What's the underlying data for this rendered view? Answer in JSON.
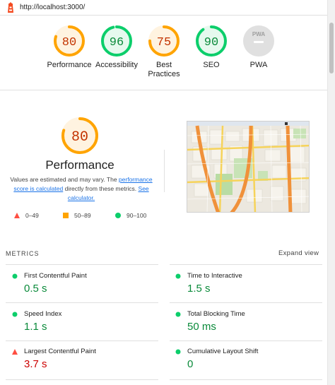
{
  "url": "http://localhost:3000/",
  "colors": {
    "pass": "#0cce6b",
    "average": "#ffa400",
    "fail": "#ff4e42",
    "pass_text": "#0a8a3a",
    "average_text": "#c33300",
    "fail_text": "#cc0000"
  },
  "gauges": [
    {
      "score": "80",
      "label": "Performance",
      "rating": "average",
      "value": 80
    },
    {
      "score": "96",
      "label": "Accessibility",
      "rating": "pass",
      "value": 96
    },
    {
      "score": "75",
      "label_line1": "Best",
      "label_line2": "Practices",
      "rating": "average",
      "value": 75
    },
    {
      "score": "90",
      "label": "SEO",
      "rating": "pass",
      "value": 90
    },
    {
      "score": "PWA",
      "label": "PWA",
      "rating": "na"
    }
  ],
  "performance": {
    "score": "80",
    "value": 80,
    "title": "Performance",
    "desc_1": "Values are estimated and may vary. The ",
    "link_1": "performance score is calculated",
    "desc_2": " directly from these metrics. ",
    "link_2": "See calculator.",
    "legend": [
      {
        "range": "0–49",
        "icon": "triangle-icon"
      },
      {
        "range": "50–89",
        "icon": "square-icon"
      },
      {
        "range": "90–100",
        "icon": "circle-icon"
      }
    ]
  },
  "metrics": {
    "title": "METRICS",
    "expand_label": "Expand view",
    "items": [
      {
        "label": "First Contentful Paint",
        "value": "0.5 s",
        "rating": "pass"
      },
      {
        "label": "Time to Interactive",
        "value": "1.5 s",
        "rating": "pass"
      },
      {
        "label": "Speed Index",
        "value": "1.1 s",
        "rating": "pass"
      },
      {
        "label": "Total Blocking Time",
        "value": "50 ms",
        "rating": "pass"
      },
      {
        "label": "Largest Contentful Paint",
        "value": "3.7 s",
        "rating": "fail"
      },
      {
        "label": "Cumulative Layout Shift",
        "value": "0",
        "rating": "pass"
      }
    ]
  }
}
